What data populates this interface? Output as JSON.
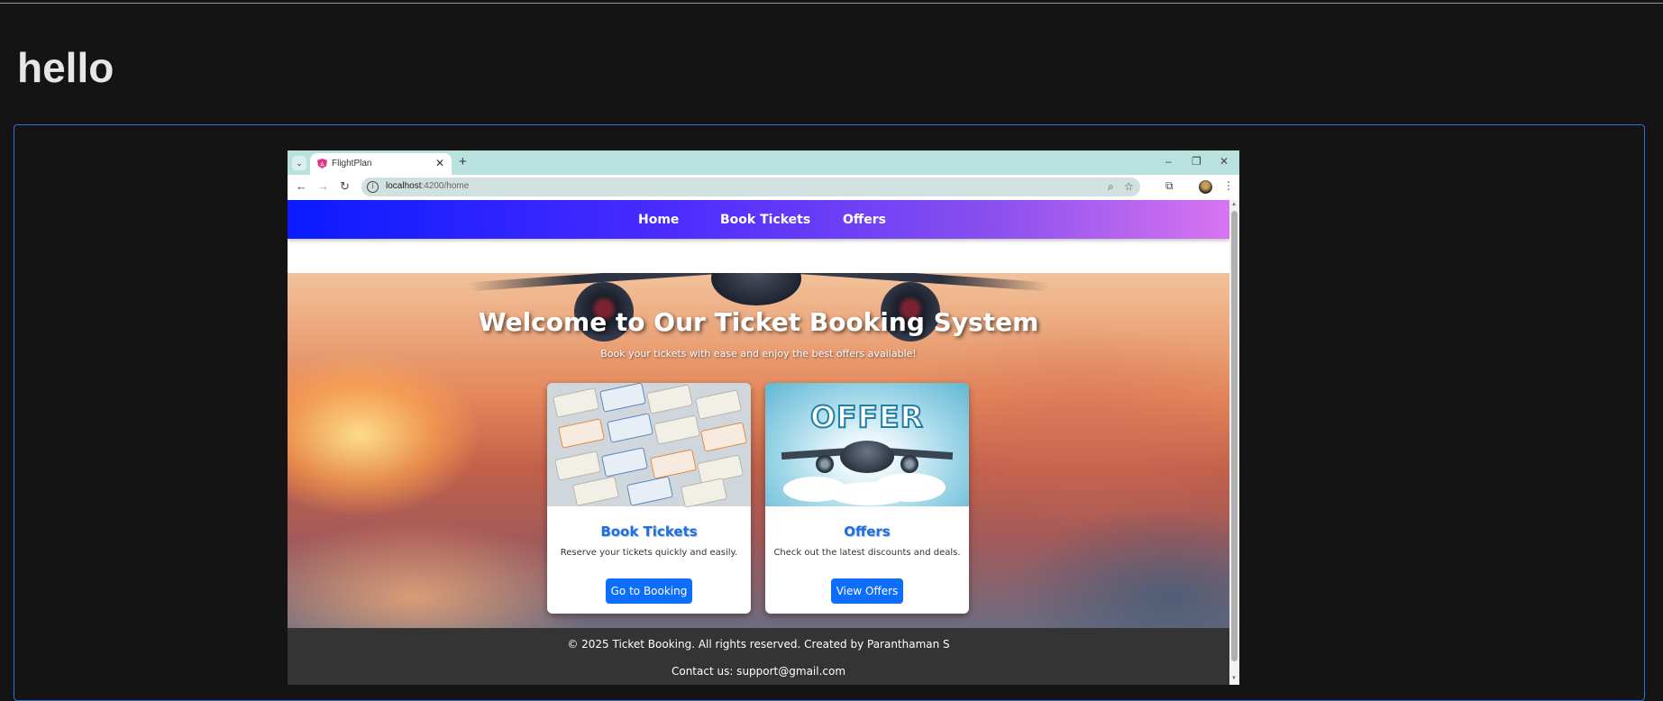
{
  "page": {
    "title": "hello"
  },
  "browser": {
    "tab_title": "FlightPlan",
    "new_tab": "+",
    "url_host": "localhost",
    "url_path": ":4200/home",
    "icons": [
      "tab-list-icon",
      "angular-favicon",
      "close-icon",
      "new-tab-icon",
      "minimize-icon",
      "restore-icon",
      "window-close-icon",
      "back-icon",
      "forward-icon",
      "reload-icon",
      "site-info-icon",
      "zoom-icon",
      "bookmark-star-icon",
      "extensions-icon",
      "profile-avatar",
      "menu-kebab-icon"
    ]
  },
  "site": {
    "nav": [
      "Home",
      "Book Tickets",
      "Offers"
    ],
    "hero": {
      "title": "Welcome to Our Ticket Booking System",
      "subtitle": "Book your tickets with ease and enjoy the best offers available!"
    },
    "cards": [
      {
        "title": "Book Tickets",
        "text": "Reserve your tickets quickly and easily.",
        "button": "Go to Booking"
      },
      {
        "title": "Offers",
        "text": "Check out the latest discounts and deals.",
        "button": "View Offers",
        "image_text": "OFFER"
      }
    ],
    "footer": {
      "line1": "© 2025 Ticket Booking. All rights reserved. Created by Paranthaman S",
      "line2": "Contact us: support@gmail.com"
    }
  },
  "colors": {
    "accent": "#0d6efd",
    "frame_border": "#2f6fe0",
    "navbar_start": "#0a1bff",
    "navbar_end": "#d874f0",
    "footer_bg": "#343434"
  }
}
